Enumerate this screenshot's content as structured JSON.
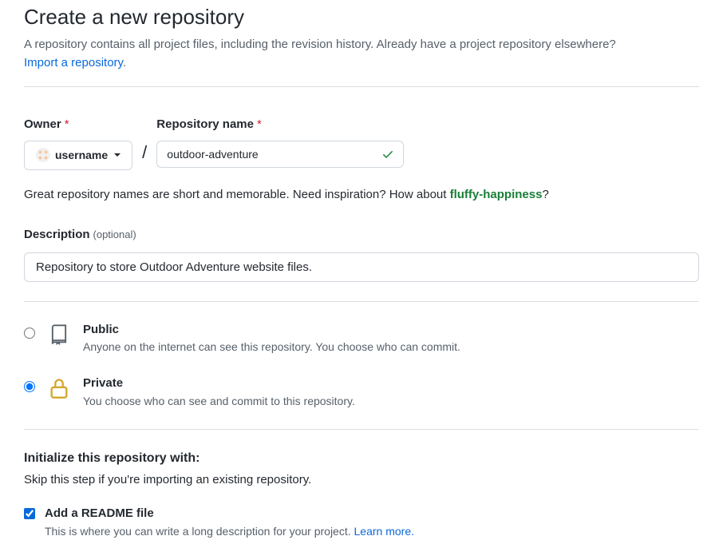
{
  "header": {
    "title": "Create a new repository",
    "subtitle": "A repository contains all project files, including the revision history. Already have a project repository elsewhere?",
    "import_link": "Import a repository"
  },
  "form": {
    "owner_label": "Owner",
    "owner_value": "username",
    "repo_name_label": "Repository name",
    "repo_name_value": "outdoor-adventure",
    "slash": "/",
    "name_hint_prefix": "Great repository names are short and memorable. Need inspiration? How about ",
    "name_suggestion": "fluffy-happiness",
    "name_hint_suffix": "?",
    "description_label": "Description",
    "description_optional": "(optional)",
    "description_value": "Repository to store Outdoor Adventure website files."
  },
  "visibility": {
    "public": {
      "title": "Public",
      "desc": "Anyone on the internet can see this repository. You choose who can commit."
    },
    "private": {
      "title": "Private",
      "desc": "You choose who can see and commit to this repository."
    }
  },
  "init": {
    "heading": "Initialize this repository with:",
    "subheading": "Skip this step if you're importing an existing repository.",
    "readme_title": "Add a README file",
    "readme_desc_prefix": "This is where you can write a long description for your project. ",
    "readme_learn_more": "Learn more."
  }
}
